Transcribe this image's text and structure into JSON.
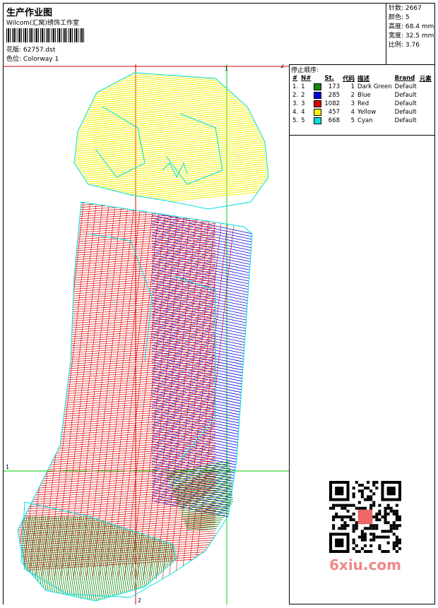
{
  "header": {
    "title": "生产作业图",
    "studio": "Wilcom(汇窝)绣饰工作室",
    "design_label": "花版:",
    "design_file": "62757.dst",
    "colorway_label": "色位:",
    "colorway": "Colorway 1"
  },
  "info": [
    {
      "label": "针数:",
      "value": "2667"
    },
    {
      "label": "颜色:",
      "value": "5"
    },
    {
      "label": "高度:",
      "value": "68.4 mm"
    },
    {
      "label": "宽度:",
      "value": "32.5 mm"
    },
    {
      "label": "比例:",
      "value": "3.76"
    }
  ],
  "thread_panel": {
    "title": "停止顺序:",
    "columns": [
      "#",
      "N#",
      "",
      "St.",
      "代码",
      "描述",
      "Brand",
      "元素"
    ],
    "rows": [
      {
        "idx": "1.",
        "n": "1",
        "color": "#0a8a0a",
        "st": "173",
        "code": "1",
        "desc": "Dark Green",
        "brand": "Default"
      },
      {
        "idx": "2.",
        "n": "2",
        "color": "#0000e0",
        "st": "285",
        "code": "2",
        "desc": "Blue",
        "brand": "Default"
      },
      {
        "idx": "3.",
        "n": "3",
        "color": "#e00000",
        "st": "1082",
        "code": "3",
        "desc": "Red",
        "brand": "Default"
      },
      {
        "idx": "4.",
        "n": "4",
        "color": "#f0f000",
        "st": "457",
        "code": "4",
        "desc": "Yellow",
        "brand": "Default"
      },
      {
        "idx": "5.",
        "n": "5",
        "color": "#00e0e0",
        "st": "668",
        "code": "5",
        "desc": "Cyan",
        "brand": "Default"
      }
    ]
  },
  "guides": {
    "top": "2",
    "bottom": "2",
    "left": "1",
    "right": "1"
  },
  "watermark": "6xiu.com"
}
